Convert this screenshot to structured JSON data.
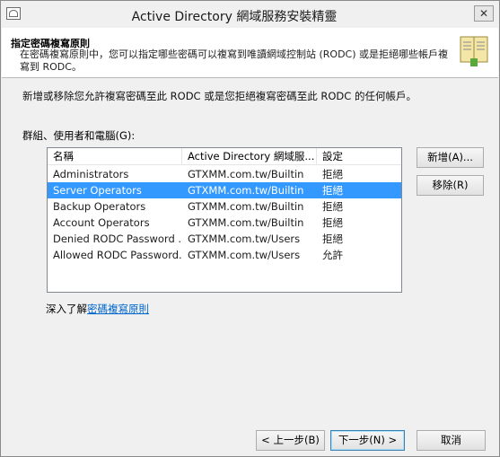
{
  "window": {
    "title": "Active Directory 網域服務安裝精靈",
    "close_label": "✕"
  },
  "header": {
    "title": "指定密碼複寫原則",
    "description": "在密碼複寫原則中，您可以指定哪些密碼可以複寫到唯讀網域控制站 (RODC) 或是拒絕哪些帳戶複寫到 RODC。"
  },
  "content": {
    "intro": "新增或移除您允許複寫密碼至此 RODC 或是您拒絕複寫密碼至此 RODC 的任何帳戶。",
    "list_label": "群組、使用者和電腦(G):",
    "columns": [
      "名稱",
      "Active Directory 網域服...",
      "設定"
    ],
    "rows": [
      {
        "name": "Administrators",
        "domain": "GTXMM.com.tw/Builtin",
        "setting": "拒絕"
      },
      {
        "name": "Server Operators",
        "domain": "GTXMM.com.tw/Builtin",
        "setting": "拒絕"
      },
      {
        "name": "Backup Operators",
        "domain": "GTXMM.com.tw/Builtin",
        "setting": "拒絕"
      },
      {
        "name": "Account Operators",
        "domain": "GTXMM.com.tw/Builtin",
        "setting": "拒絕"
      },
      {
        "name": "Denied RODC Password ...",
        "domain": "GTXMM.com.tw/Users",
        "setting": "拒絕"
      },
      {
        "name": "Allowed RODC Password...",
        "domain": "GTXMM.com.tw/Users",
        "setting": "允許"
      }
    ],
    "add_button": "新增(A)...",
    "remove_button": "移除(R)",
    "learn_prefix": "深入了解",
    "learn_link": "密碼複寫原則"
  },
  "footer": {
    "back_button": "< 上一步(B)",
    "next_button": "下一步(N) >",
    "cancel_button": "取消"
  }
}
